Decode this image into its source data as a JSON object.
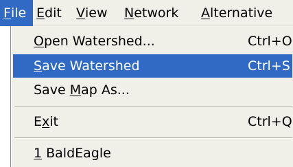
{
  "menubar": {
    "items": [
      {
        "label": "File",
        "mnemonic": "F",
        "rest": "ile",
        "active": true
      },
      {
        "label": "Edit",
        "mnemonic": "E",
        "rest": "dit"
      },
      {
        "label": "View",
        "mnemonic": "V",
        "rest": "iew"
      },
      {
        "label": "Network",
        "mnemonic": "N",
        "rest": "etwork"
      },
      {
        "label": "Alternative",
        "mnemonic": "A",
        "rest": "lternative"
      }
    ]
  },
  "file_menu": {
    "items": [
      {
        "label": "Open Watershed...",
        "pre": "",
        "mnemonic": "O",
        "post": "pen Watershed...",
        "shortcut": "Ctrl+O"
      },
      {
        "label": "Save Watershed",
        "pre": "",
        "mnemonic": "S",
        "post": "ave Watershed",
        "shortcut": "Ctrl+S",
        "selected": true
      },
      {
        "label": "Save Map As...",
        "pre": "Save ",
        "mnemonic": "M",
        "post": "ap As...",
        "shortcut": ""
      },
      {
        "label": "Exit",
        "pre": "E",
        "mnemonic": "x",
        "post": "it",
        "shortcut": "Ctrl+Q"
      },
      {
        "label": "1 BaldEagle",
        "pre": "",
        "mnemonic": "1",
        "post": " BaldEagle",
        "shortcut": ""
      }
    ]
  },
  "colors": {
    "highlight": "#316ac5",
    "menu_background": "#f0efe8",
    "highlight_text": "#ffffff"
  }
}
